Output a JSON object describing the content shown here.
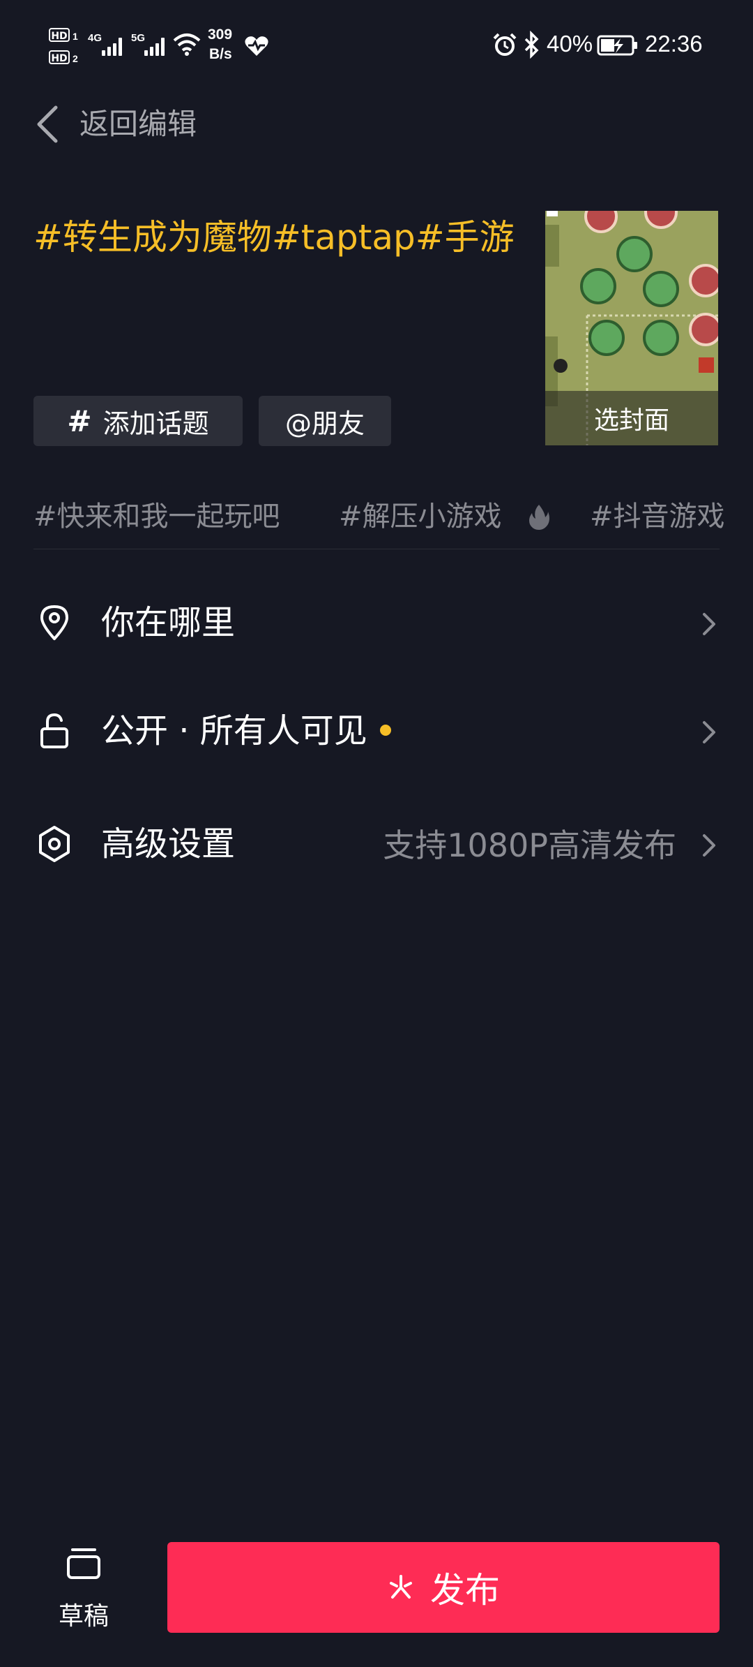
{
  "status_bar": {
    "sim1": "HD",
    "sim1_index": "1",
    "sim2": "HD",
    "sim2_index": "2",
    "net1": "4G",
    "net2": "5G",
    "speed_value": "309",
    "speed_unit": "B/s",
    "battery": "40%",
    "time": "22:36"
  },
  "header": {
    "back_label": "返回编辑"
  },
  "caption": {
    "text": "#转生成为魔物#taptap#手游"
  },
  "chips": {
    "topic": "添加话题",
    "friend": "@朋友"
  },
  "cover": {
    "label": "选封面"
  },
  "suggested_tags": [
    "#快来和我一起玩吧",
    "#解压小游戏",
    "#抖音游戏"
  ],
  "rows": {
    "location": "你在哪里",
    "privacy": "公开 · 所有人可见",
    "advanced": "高级设置",
    "advanced_value": "支持1080P高清发布"
  },
  "bottom": {
    "draft": "草稿",
    "publish": "发布"
  },
  "colors": {
    "background": "#161823",
    "accent_yellow": "#f6be27",
    "publish_red": "#fe2c55"
  }
}
